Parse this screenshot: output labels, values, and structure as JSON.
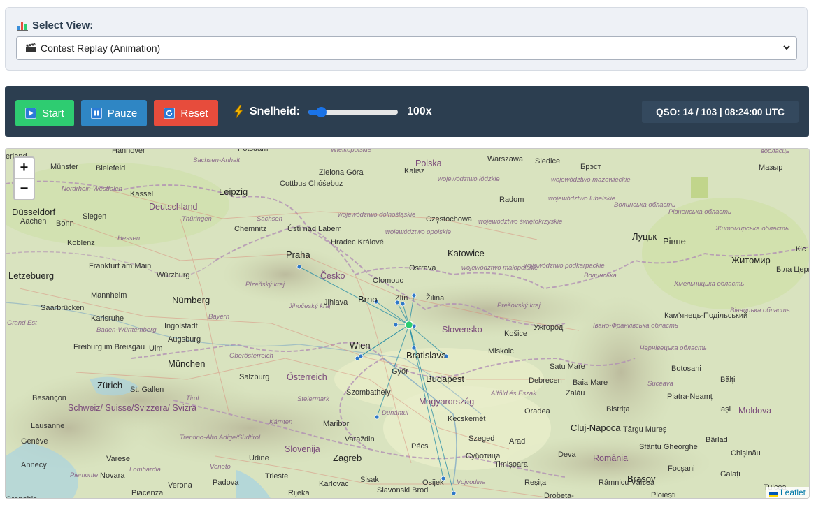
{
  "view_selector": {
    "label": "Select View:",
    "label_icon": "bar-chart-icon",
    "selected": "Contest Replay (Animation)",
    "selected_icon": "clapper-board-icon"
  },
  "controls": {
    "start_label": "Start",
    "pause_label": "Pauze",
    "reset_label": "Reset",
    "speed_label": "Snelheid:",
    "speed_icon": "lightning-icon",
    "speed_value": "100x",
    "speed_slider_fraction": 0.14,
    "qso_status": "QSO: 14 / 103 | 08:24:00 UTC"
  },
  "map": {
    "zoom_in": "+",
    "zoom_out": "−",
    "attribution": "Leaflet",
    "labels": [
      "erland",
      "Hannover",
      "Potsdam",
      "Wielkopolskie",
      "Polska",
      "Warszawa",
      "Siedlce",
      "Брэст",
      "вобласць",
      "Мазыр",
      "Münster",
      "Bielefeld",
      "Sachsen-Anhalt",
      "Zielona Góra",
      "Kalisz",
      "województwo łódzkie",
      "województwo mazowieckie",
      "Nordrhein-Westfalen",
      "Kassel",
      "Leipzig",
      "Cottbus Chóśebuz",
      "województwo dolnośląskie",
      "Radom",
      "województwo lubelskie",
      "Волинська область",
      "Рівненська область",
      "Düsseldorf",
      "Deutschland",
      "Siegen",
      "Aachen",
      "Bonn",
      "Thüringen",
      "Sachsen",
      "Chemnitz",
      "Częstochowa",
      "województwo świętokrzyskie",
      "Луцьк",
      "Рівне",
      "Житомирська область",
      "Koblenz",
      "Hessen",
      "Ústí nad Labem",
      "Hradec Králové",
      "województwo opolskie",
      "Katowice",
      "Житомир",
      "Frankfurt am Main",
      "Würzburg",
      "Praha",
      "Česko",
      "Ostrava",
      "województwo małopolskie",
      "województwo podkarpackie",
      "Волинська",
      "Біла Церк",
      "Letzebuerg",
      "Mannheim",
      "Nürnberg",
      "Plzeňský kraj",
      "Olomouc",
      "Brno",
      "Zlín",
      "Žilina",
      "Хмельницька область",
      "Saarbrücken",
      "Jihlava",
      "Jihočeský kraj",
      "Karlsruhe",
      "Bayern",
      "Grand Est",
      "Baden-Württemberg",
      "Ingolstadt",
      "Prešovský kraj",
      "Кам'янець-Подільський",
      "Вінницька область",
      "Slovensko",
      "Ужгород",
      "Івано-Франківська область",
      "Košice",
      "Augsburg",
      "Ulm",
      "Freiburg im Breisgau",
      "Wien",
      "Bratislava",
      "Miskolc",
      "Чернівецька область",
      "Oberösterreich",
      "München",
      "Salzburg",
      "Österreich",
      "Satu Mare",
      "Botoșani",
      "Bălți",
      "Győr",
      "Budapest",
      "Zürich",
      "St. Gallen",
      "Debrecen",
      "Baia Mare",
      "Suceava",
      "Besançon",
      "Tirol",
      "Steiermark",
      "Szombathely",
      "Magyarország",
      "Alföld és Észak",
      "Zalău",
      "Bistrița",
      "Piatra-Neamț",
      "Iași",
      "Moldova",
      "Schweiz/ Suisse/Svizzera/ Svizra",
      "Dunántúl",
      "Kecskemét",
      "Oradea",
      "Lausanne",
      "Kärnten",
      "Maribor",
      "Cluj-Napoca",
      "Târgu Mureș",
      "Genève",
      "Trentino-Alto Adige/Südtirol",
      "Varaždin",
      "Szeged",
      "Arad",
      "Bârlad",
      "Varese",
      "Slovenija",
      "Pécs",
      "Суботица",
      "Timișoara",
      "Deva",
      "Sfântu Gheorghe",
      "Chișinău",
      "Annecy",
      "Lombardia",
      "Udine",
      "Veneto",
      "Zagreb",
      "România",
      "Focșani",
      "Piemonte",
      "Novara",
      "Trieste",
      "Sisak",
      "Osijek",
      "Brașov",
      "Galați",
      "Verona",
      "Padova",
      "Karlovac",
      "Slavonski Brod",
      "Vojvodina",
      "Reșița",
      "Râmnicu Vâlcea",
      "Tulcea",
      "Piacenza",
      "Rijeka",
      "Drobeta-",
      "Ploiești",
      "Grenoble",
      "Кіє"
    ]
  }
}
